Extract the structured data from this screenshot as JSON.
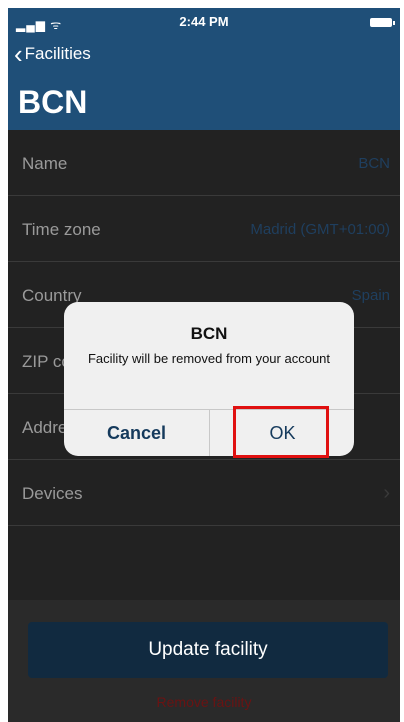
{
  "status": {
    "signal": "all",
    "time": "2:44 PM"
  },
  "nav": {
    "back_label": "Facilities",
    "title": "BCN"
  },
  "rows": [
    {
      "label": "Name",
      "value": "BCN"
    },
    {
      "label": "Time zone",
      "value": "Madrid (GMT+01:00)"
    },
    {
      "label": "Country",
      "value": "Spain"
    },
    {
      "label": "ZIP code",
      "value": ""
    },
    {
      "label": "Address",
      "value": ""
    },
    {
      "label": "Devices",
      "value": ""
    }
  ],
  "footer": {
    "update_label": "Update facility",
    "remove_label": "Remove facility"
  },
  "alert": {
    "title": "BCN",
    "message": "Facility will be removed from your account",
    "cancel_label": "Cancel",
    "ok_label": "OK"
  },
  "colors": {
    "header": "#1f4f78",
    "accent": "#153a5c",
    "highlight": "#e01010",
    "remove": "#6a1313"
  }
}
